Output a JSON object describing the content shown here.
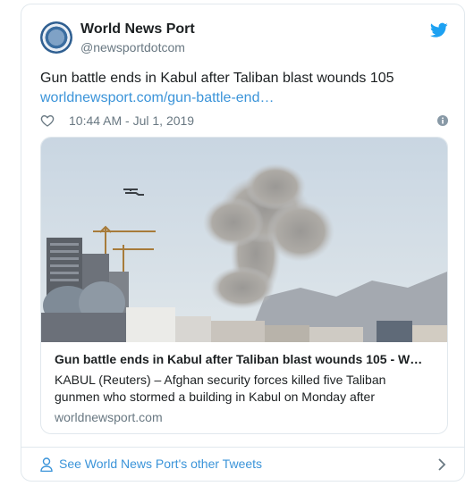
{
  "author": {
    "name": "World News Port",
    "handle": "@newsportdotcom"
  },
  "tweet": {
    "text": "Gun battle ends in Kabul after Taliban blast wounds 105",
    "link": "worldnewsport.com/gun-battle-end…",
    "timestamp": "10:44 AM - Jul 1, 2019"
  },
  "media_card": {
    "title": "Gun battle ends in Kabul after Taliban blast wounds 105 - W…",
    "description": "KABUL (Reuters) – Afghan security forces killed five Taliban gunmen who stormed a building in Kabul on Monday after",
    "domain": "worldnewsport.com"
  },
  "footer": {
    "label": "See World News Port's other Tweets"
  },
  "icons": [
    "twitter-bird-icon",
    "heart-icon",
    "info-icon",
    "person-icon",
    "chevron-right-icon"
  ],
  "colors": {
    "link": "#3b94d9",
    "secondary_text": "#697882",
    "border": "#e1e8ed",
    "brand": "#1da1f2"
  }
}
